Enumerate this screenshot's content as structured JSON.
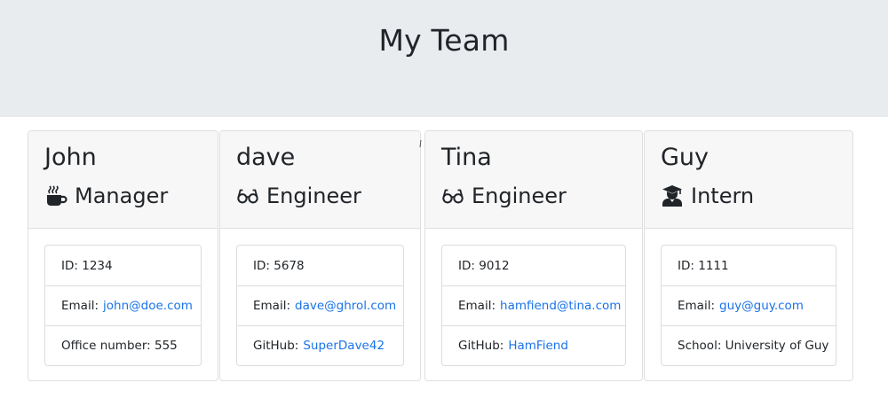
{
  "header": {
    "title": "My Team"
  },
  "employees": [
    {
      "name": "John",
      "role": "Manager",
      "icon": "coffee-mug-icon",
      "id_label": "ID:",
      "id": "1234",
      "email_label": "Email:",
      "email": "john@doe.com",
      "extra_label": "Office number:",
      "extra": "555"
    },
    {
      "name": "dave",
      "role": "Engineer",
      "icon": "glasses-icon",
      "id_label": "ID:",
      "id": "5678",
      "email_label": "Email:",
      "email": "dave@ghrol.com",
      "extra_label": "GitHub:",
      "extra": "SuperDave42"
    },
    {
      "name": "Tina",
      "role": "Engineer",
      "icon": "glasses-icon",
      "id_label": "ID:",
      "id": "9012",
      "email_label": "Email:",
      "email": "hamfiend@tina.com",
      "extra_label": "GitHub:",
      "extra": "HamFiend"
    },
    {
      "name": "Guy",
      "role": "Intern",
      "icon": "graduate-icon",
      "id_label": "ID:",
      "id": "1111",
      "email_label": "Email:",
      "email": "guy@guy.com",
      "extra_label": "School:",
      "extra": "University of Guy"
    }
  ],
  "colors": {
    "jumbotron_bg": "#e9ecef",
    "card_header_bg": "#f7f7f7",
    "link": "#1a73e8",
    "text": "#212529"
  }
}
